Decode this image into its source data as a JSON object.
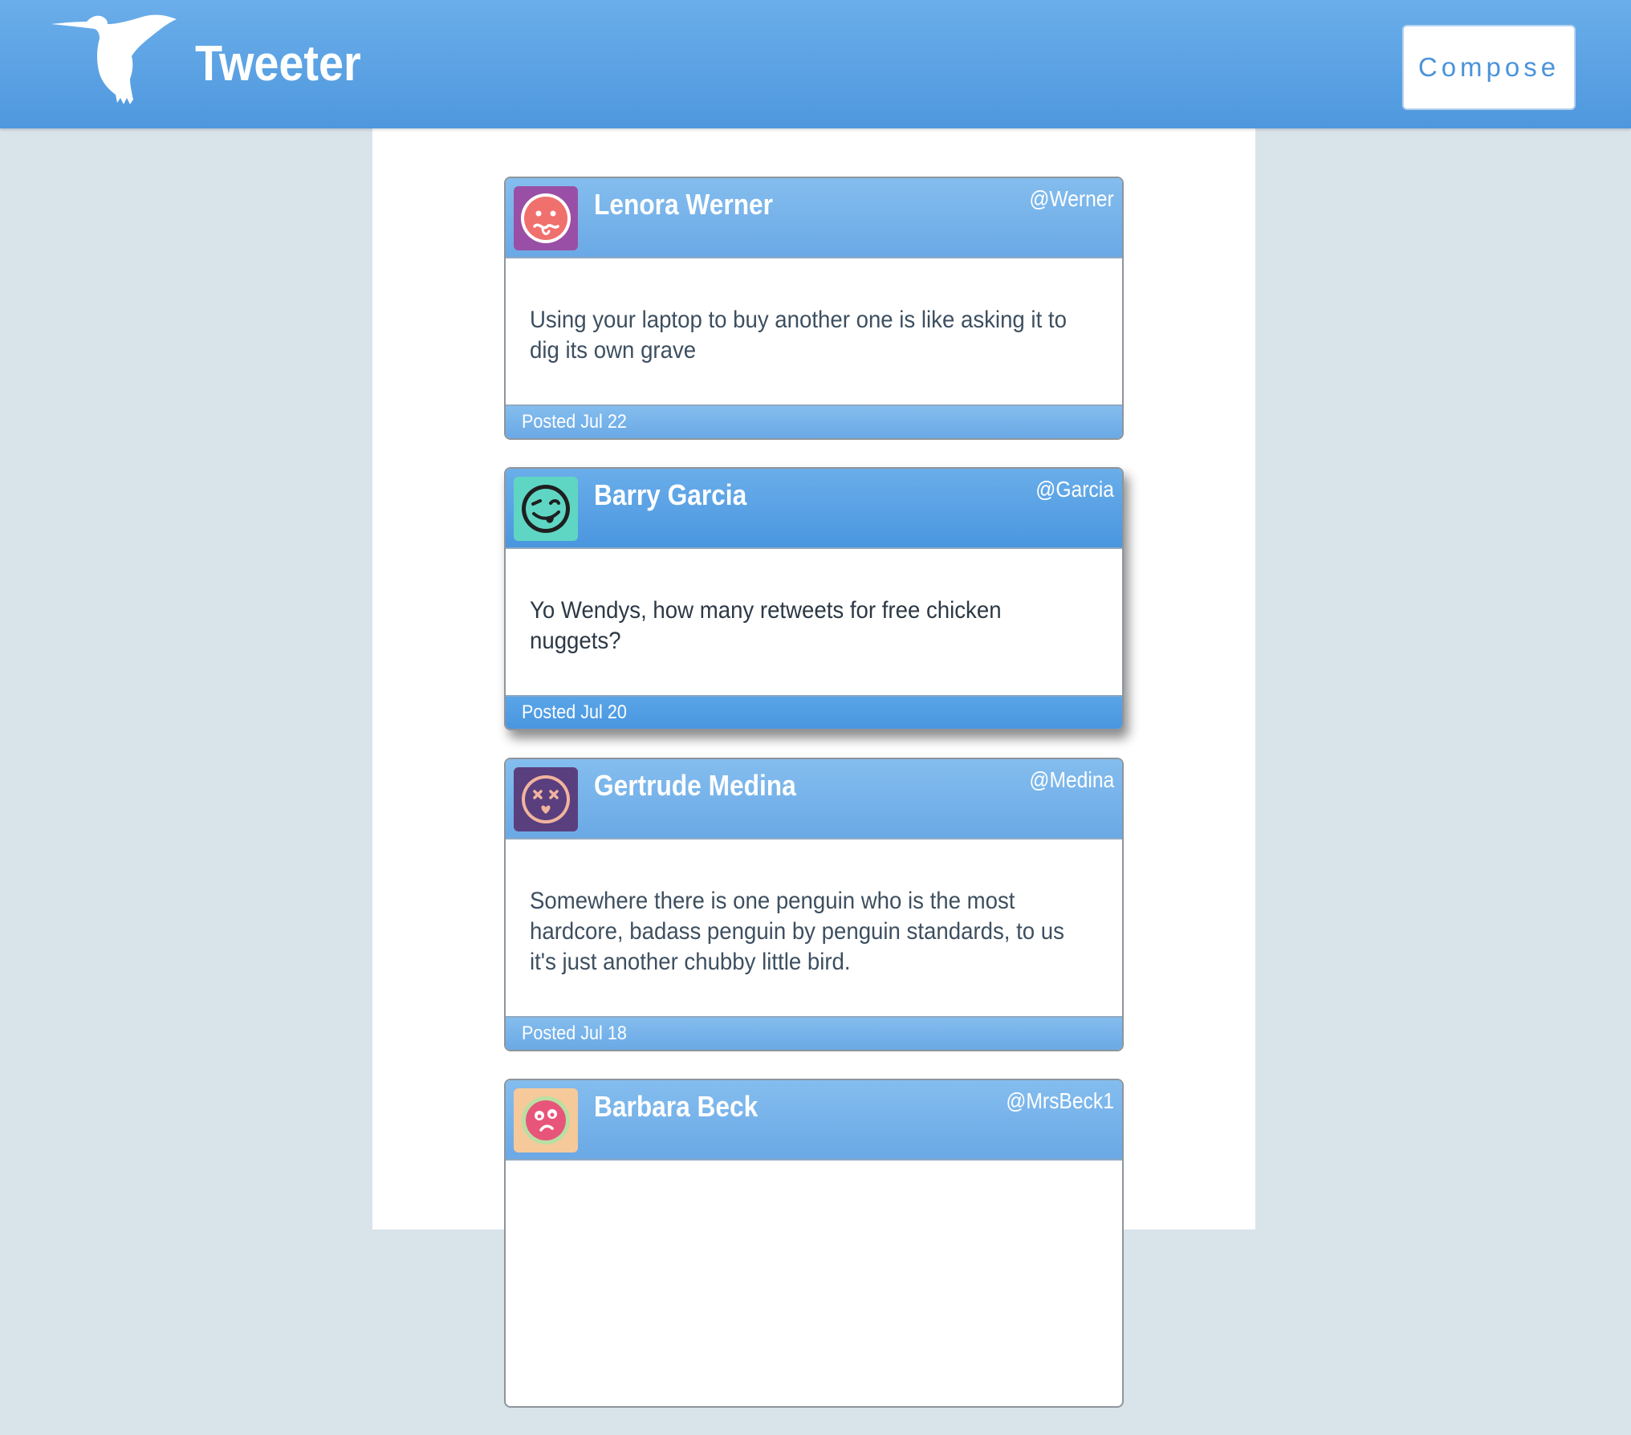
{
  "header": {
    "brand": "Tweeter",
    "compose_label": "Compose",
    "logo_icon": "hummingbird-icon"
  },
  "colors": {
    "navbar": "#5aa3e6",
    "page_background": "#d9e3ea",
    "card_header": "#78b4eb",
    "compose_text": "#4a93db"
  },
  "tweets": [
    {
      "name": "Lenora Werner",
      "handle": "@Werner",
      "text": "Using your laptop to buy another one is like asking it to dig its own grave",
      "posted": "Posted Jul 22",
      "avatar_icon": "sick-face-avatar",
      "avatar_bg": "#9a4fa6"
    },
    {
      "name": "Barry Garcia",
      "handle": "@Garcia",
      "text": "Yo Wendys, how many retweets for free chicken nuggets?",
      "posted": "Posted Jul 20",
      "avatar_icon": "tongue-out-face-avatar",
      "avatar_bg": "#5fd6c4"
    },
    {
      "name": "Gertrude Medina",
      "handle": "@Medina",
      "text": "Somewhere there is one penguin who is the most hardcore, badass penguin by penguin standards, to us it's just another chubby little bird.",
      "posted": "Posted Jul 18",
      "avatar_icon": "dizzy-face-avatar",
      "avatar_bg": "#5a3f7e"
    },
    {
      "name": "Barbara Beck",
      "handle": "@MrsBeck1",
      "text": "",
      "posted": "",
      "avatar_icon": "shocked-face-avatar",
      "avatar_bg": "#f6c99a"
    }
  ]
}
